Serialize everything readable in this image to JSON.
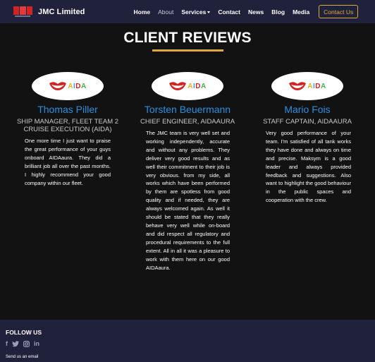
{
  "navbar": {
    "brand": "JMC Limited",
    "links": [
      "Home",
      "About",
      "Services",
      "Contact",
      "News",
      "Blog",
      "Media"
    ],
    "cta": "Contact Us"
  },
  "section": {
    "title": "CLIENT REVIEWS"
  },
  "reviews": [
    {
      "logo_text": "AIDA",
      "name": "Thomas Piller",
      "role": "SHIP MANAGER, FLEET TEAM 2 CRUISE EXECUTION (AIDA)",
      "text": "One more time I just want to praise the great performance of your guys onboard AIDAaura. They did a brilliant job all over the past months. I highly recommend your good company within our fleet."
    },
    {
      "logo_text": "AIDA",
      "name": "Torsten Beuermann",
      "role": "CHIEF ENGINEER, AIDAAURA",
      "text": "The JMC team is very well set and working independently, accurate and without any problems. They deliver very good results and as well their commitment to their job is very obvious. from my side, all works which have been performed by them are spotless from good quality and if needed, they are always welcomed again. As well it should be stated that they really behave very well while on-board and did respect all regulatory and procedural requirements to the full extent. All in all it was a pleasure to work with them here on our good AIDAaura."
    },
    {
      "logo_text": "AIDA",
      "name": "Mario Fois",
      "role": "STAFF CAPTAIN, AIDAAURA",
      "text": "Very good performance of your team. I'm satisfied of all tank works they have done and always on time and precise. Maksym is a good leader and always provided feedback and suggestions. Also want to highlight the good behaviour in the public spaces and cooperation with the crew."
    }
  ],
  "footer": {
    "follow_label": "FOLLOW US",
    "social_icons": [
      "facebook-icon",
      "twitter-icon",
      "instagram-icon",
      "linkedin-icon"
    ],
    "send_label": "Send us an email"
  },
  "colors": {
    "nav_bg": "#20213b",
    "page_bg": "#121212",
    "accent": "#e0a840",
    "name_blue": "#2b8fe0",
    "aida_red": "#d42323"
  }
}
